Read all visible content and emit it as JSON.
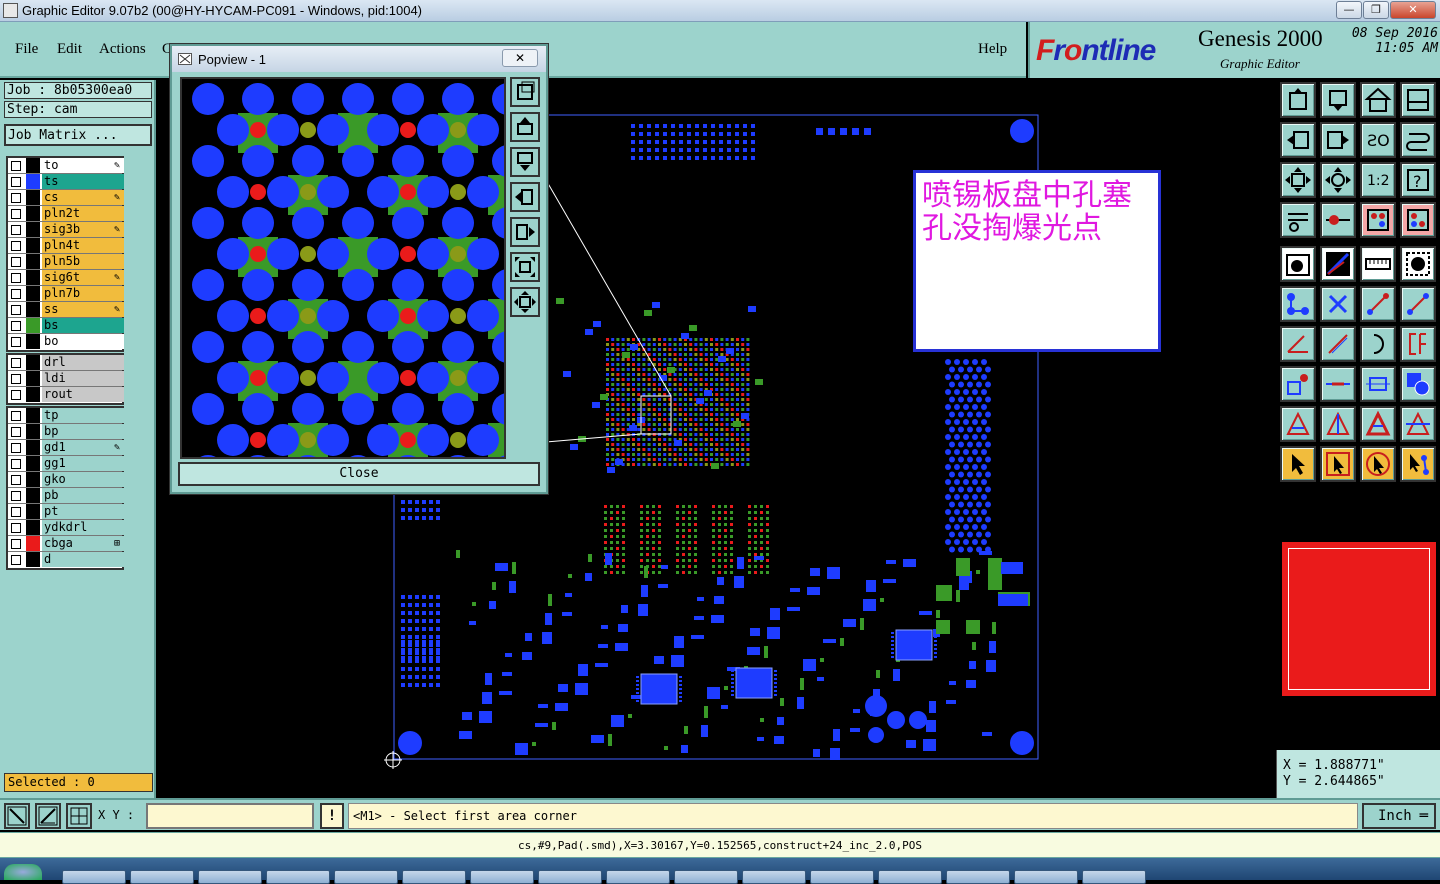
{
  "window": {
    "title": "Graphic Editor 9.07b2 (00@HY-HYCAM-PC091 - Windows, pid:1004)",
    "min_label": "—",
    "max_label": "❐",
    "close_label": "✕"
  },
  "menu": {
    "items": [
      "File",
      "Edit",
      "Actions",
      "G"
    ],
    "help": "Help"
  },
  "brand": {
    "logo_prefix": "F",
    "logo_text": "r",
    "logo_rest": "ntline",
    "logo_o": "o",
    "product": "Genesis 2000",
    "subtitle": "Graphic Editor",
    "date": "08 Sep 2016",
    "time": "11:05 AM"
  },
  "job": {
    "job_label": "Job : 8b05300ea0",
    "step_label": "Step: cam",
    "matrix_button": "Job Matrix ..."
  },
  "layers": {
    "group1": [
      {
        "name": "to",
        "color": "#ffffff",
        "swatch": "#000000",
        "mark": "✎"
      },
      {
        "name": "ts",
        "color": "#1da58f",
        "swatch": "#1e3cff",
        "mark": ""
      },
      {
        "name": "cs",
        "color": "#f1bc3d",
        "swatch": "#000000",
        "mark": "✎"
      },
      {
        "name": "pln2t",
        "color": "#f1bc3d",
        "swatch": "#000000",
        "mark": ""
      },
      {
        "name": "sig3b",
        "color": "#f1bc3d",
        "swatch": "#000000",
        "mark": "✎"
      },
      {
        "name": "pln4t",
        "color": "#f1bc3d",
        "swatch": "#000000",
        "mark": ""
      },
      {
        "name": "pln5b",
        "color": "#f1bc3d",
        "swatch": "#000000",
        "mark": ""
      },
      {
        "name": "sig6t",
        "color": "#f1bc3d",
        "swatch": "#000000",
        "mark": "✎"
      },
      {
        "name": "pln7b",
        "color": "#f1bc3d",
        "swatch": "#000000",
        "mark": ""
      },
      {
        "name": "ss",
        "color": "#f1bc3d",
        "swatch": "#000000",
        "mark": "✎"
      },
      {
        "name": "bs",
        "color": "#1da58f",
        "swatch": "#3a9a28",
        "mark": ""
      },
      {
        "name": "bo",
        "color": "#ffffff",
        "swatch": "#000000",
        "mark": ""
      }
    ],
    "group2": [
      {
        "name": "drl",
        "color": "#c8c8c8",
        "swatch": "#000000",
        "mark": ""
      },
      {
        "name": "ldi",
        "color": "#c8c8c8",
        "swatch": "#000000",
        "mark": ""
      },
      {
        "name": "rout",
        "color": "#c8c8c8",
        "swatch": "#000000",
        "mark": ""
      }
    ],
    "group3": [
      {
        "name": "tp",
        "color": "#9cd3cc",
        "swatch": "#000000",
        "mark": ""
      },
      {
        "name": "bp",
        "color": "#9cd3cc",
        "swatch": "#000000",
        "mark": ""
      },
      {
        "name": "gd1",
        "color": "#9cd3cc",
        "swatch": "#000000",
        "mark": "✎"
      },
      {
        "name": "gg1",
        "color": "#9cd3cc",
        "swatch": "#000000",
        "mark": ""
      },
      {
        "name": "gko",
        "color": "#9cd3cc",
        "swatch": "#000000",
        "mark": ""
      },
      {
        "name": "pb",
        "color": "#9cd3cc",
        "swatch": "#000000",
        "mark": ""
      },
      {
        "name": "pt",
        "color": "#9cd3cc",
        "swatch": "#000000",
        "mark": ""
      },
      {
        "name": "ydkdrl",
        "color": "#9cd3cc",
        "swatch": "#000000",
        "mark": ""
      },
      {
        "name": "cbga",
        "color": "#9cd3cc",
        "swatch": "#ea1b1b",
        "mark": "⊞"
      },
      {
        "name": "d",
        "color": "#9cd3cc",
        "swatch": "#000000",
        "mark": ""
      }
    ]
  },
  "selected": "Selected : 0",
  "popview": {
    "title": "Popview - 1",
    "close_x": "✕",
    "close_button": "Close"
  },
  "annotation": {
    "text": "喷锡板盘中孔塞孔没掏爆光点"
  },
  "coords": {
    "x": "X = 1.888771\"",
    "y": "Y = 2.644865\""
  },
  "command": {
    "xy_label": "X Y :",
    "xy_value": "",
    "warn_label": "!",
    "message": "<M1> - Select first area corner",
    "unit": "Inch"
  },
  "status": "cs,#9,Pad(.smd),X=3.30167,Y=0.152565,construct+24_inc_2.0,POS",
  "colors": {
    "panel": "#9cd3cc",
    "pad_blue": "#1e3cff",
    "pad_green": "#3a9a28",
    "pad_olive": "#8a9a18",
    "drill_red": "#ea1b1b",
    "annotation_text": "#e018e0"
  }
}
